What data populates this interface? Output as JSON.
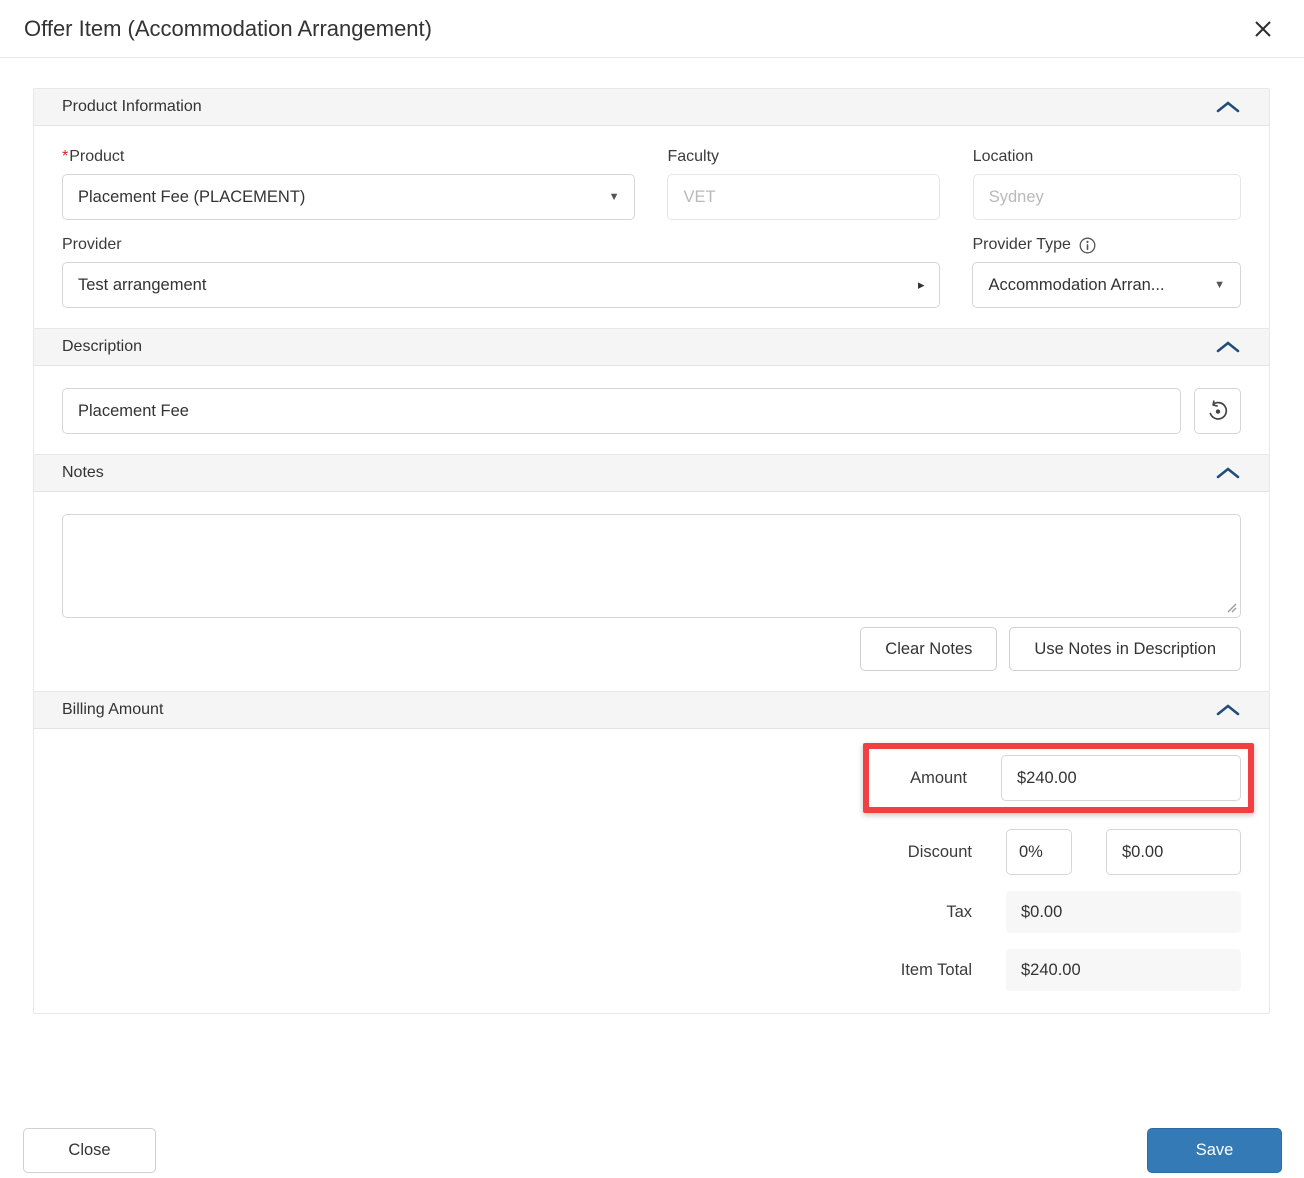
{
  "modal": {
    "title": "Offer Item (Accommodation Arrangement)"
  },
  "sections": {
    "product_information": {
      "title": "Product Information",
      "product": {
        "label": "Product",
        "required_mark": "*",
        "value": "Placement Fee (PLACEMENT)"
      },
      "faculty": {
        "label": "Faculty",
        "value": "VET"
      },
      "location": {
        "label": "Location",
        "value": "Sydney"
      },
      "provider": {
        "label": "Provider",
        "value": "Test arrangement"
      },
      "provider_type": {
        "label": "Provider Type",
        "value": "Accommodation Arran..."
      }
    },
    "description": {
      "title": "Description",
      "value": "Placement Fee"
    },
    "notes": {
      "title": "Notes",
      "value": "",
      "clear_button": "Clear Notes",
      "use_button": "Use Notes in Description"
    },
    "billing": {
      "title": "Billing Amount",
      "amount": {
        "label": "Amount",
        "value": "$240.00"
      },
      "discount": {
        "label": "Discount",
        "percent_value": "0%",
        "amount_value": "$0.00"
      },
      "tax": {
        "label": "Tax",
        "value": "$0.00"
      },
      "item_total": {
        "label": "Item Total",
        "value": "$240.00"
      }
    }
  },
  "footer": {
    "close_label": "Close",
    "save_label": "Save"
  },
  "colors": {
    "highlight_red": "#f43f42",
    "save_blue": "#337ab7",
    "chevron_navy": "#1f4e7a"
  }
}
